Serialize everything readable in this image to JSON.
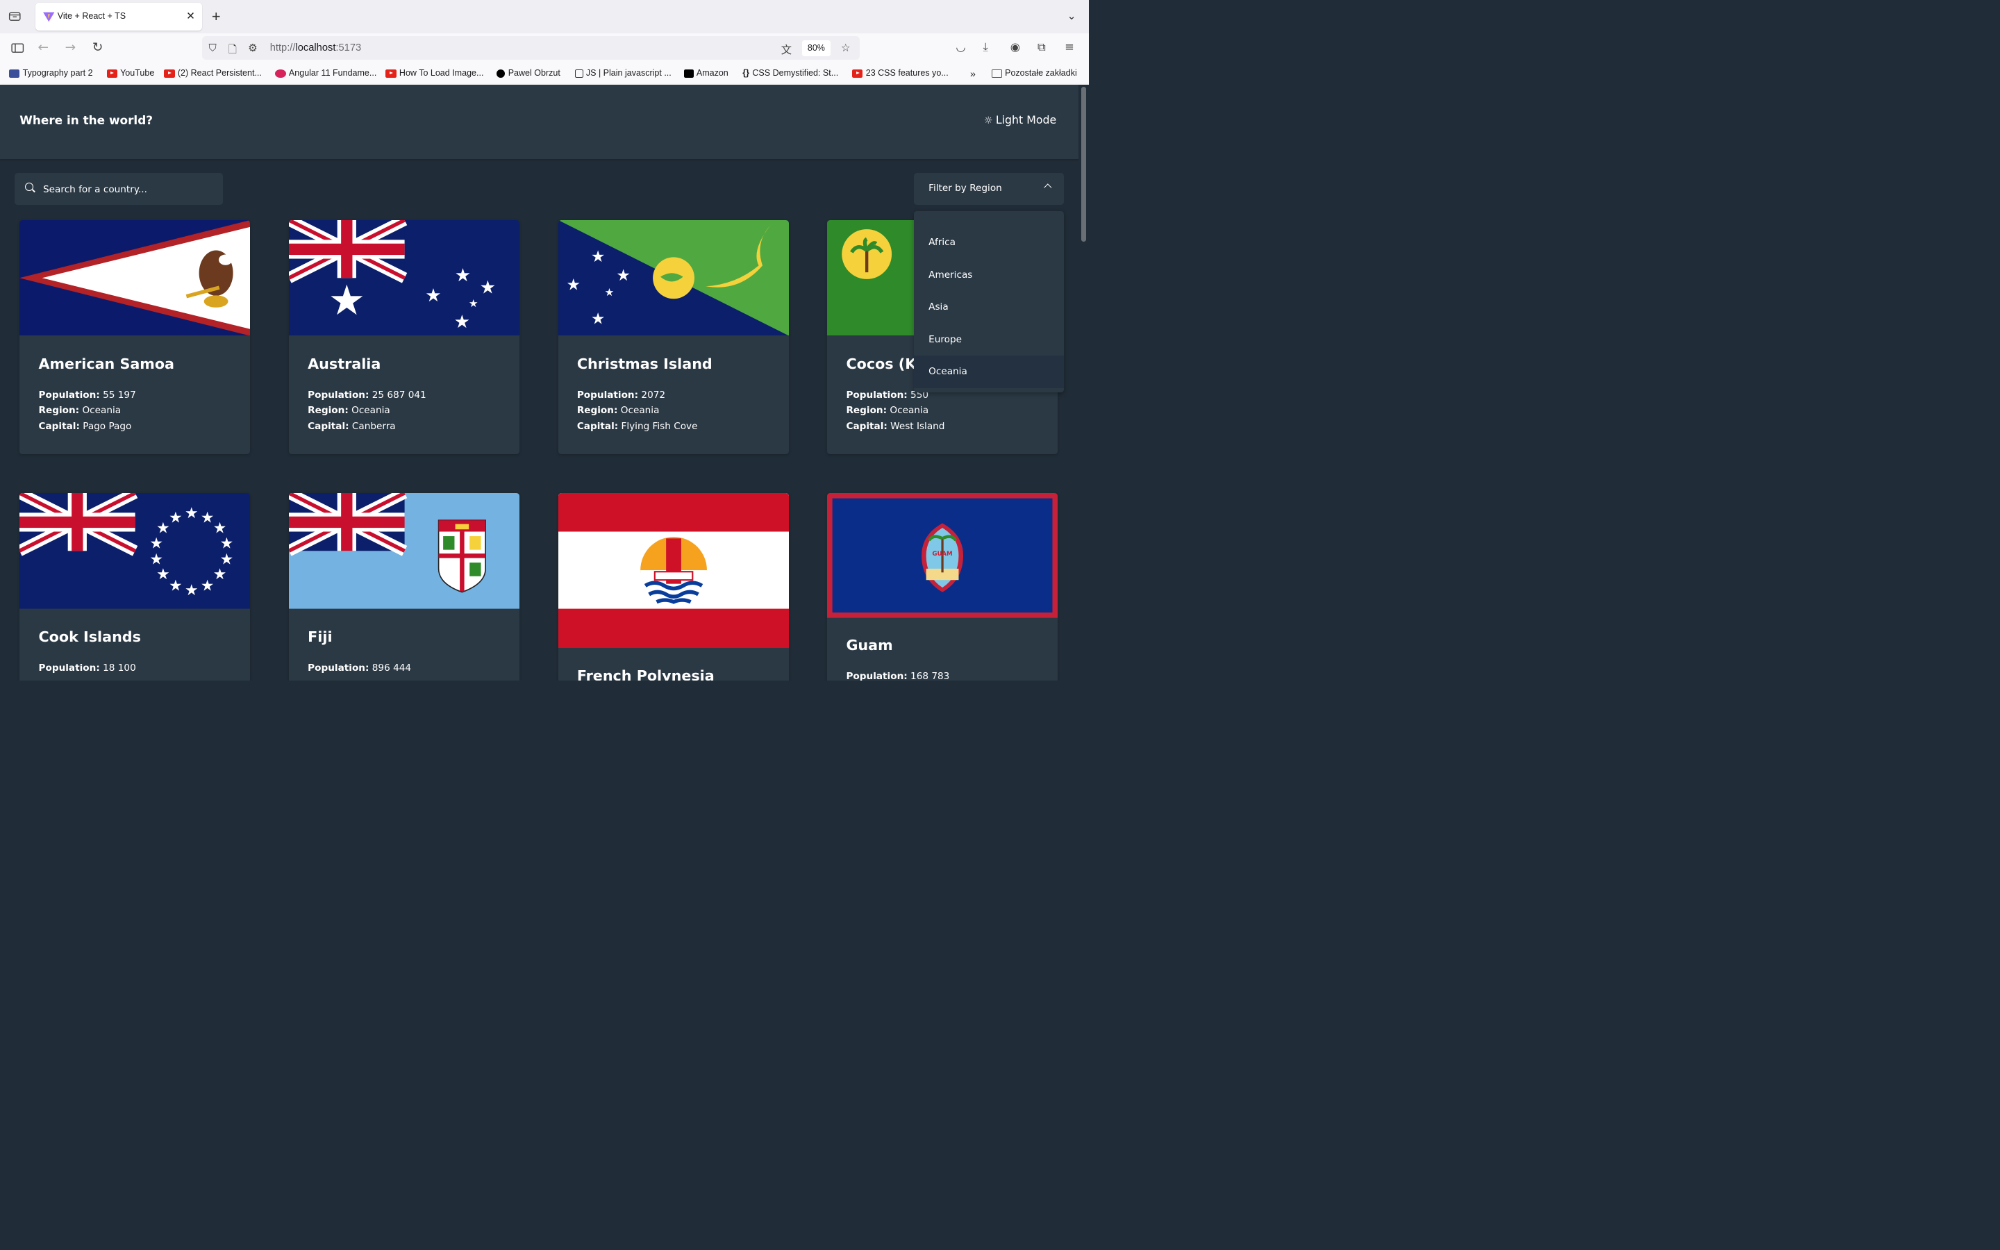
{
  "browser": {
    "tab_title": "Vite + React + TS",
    "url_protocol": "http://",
    "url_host": "localhost",
    "url_port": ":5173",
    "zoom": "80%",
    "bookmarks": [
      "Typography part 2",
      "YouTube",
      "(2) React Persistent...",
      "Angular 11 Fundame...",
      "How To Load Image...",
      "Pawel Obrzut",
      "JS | Plain javascript ...",
      "Amazon",
      "CSS Demystified: St...",
      "23 CSS features yo...",
      "Pozostałe zakładki"
    ]
  },
  "header": {
    "title": "Where in the world?",
    "mode_label": "Light Mode"
  },
  "search": {
    "placeholder": "Search for a country..."
  },
  "filter": {
    "label": "Filter by Region",
    "options": [
      "Africa",
      "Americas",
      "Asia",
      "Europe",
      "Oceania"
    ],
    "selected": "Oceania"
  },
  "labels": {
    "population": "Population:",
    "region": "Region:",
    "capital": "Capital:"
  },
  "countries": [
    {
      "name": "American Samoa",
      "population": "55 197",
      "region": "Oceania",
      "capital": "Pago Pago"
    },
    {
      "name": "Australia",
      "population": "25 687 041",
      "region": "Oceania",
      "capital": "Canberra"
    },
    {
      "name": "Christmas Island",
      "population": "2072",
      "region": "Oceania",
      "capital": "Flying Fish Cove"
    },
    {
      "name": "Cocos (Keeling) Islands",
      "population": "550",
      "region": "Oceania",
      "capital": "West Island"
    },
    {
      "name": "Cook Islands",
      "population": "18 100"
    },
    {
      "name": "Fiji",
      "population": "896 444"
    },
    {
      "name": "French Polynesia"
    },
    {
      "name": "Guam",
      "population": "168 783"
    }
  ]
}
